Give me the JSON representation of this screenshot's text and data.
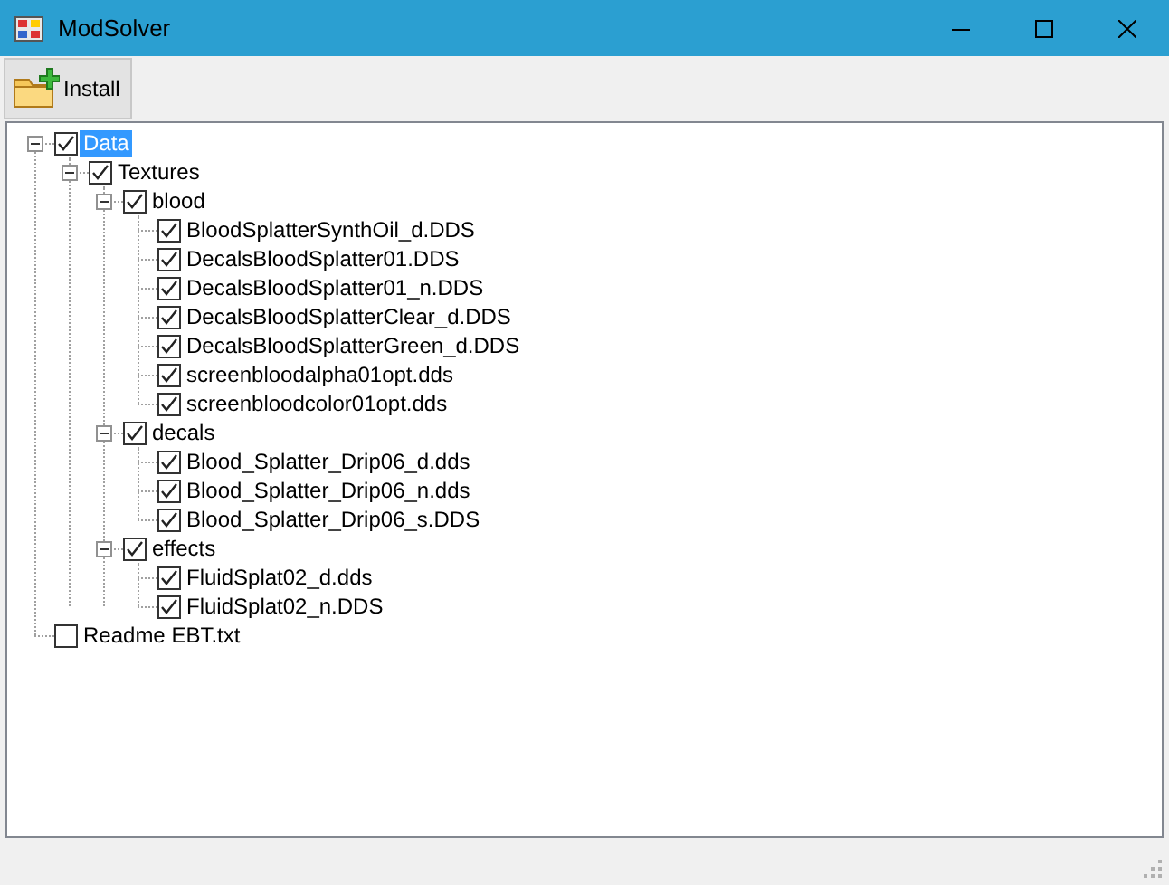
{
  "window": {
    "title": "ModSolver"
  },
  "toolbar": {
    "buttons": [
      {
        "label": "Install"
      }
    ]
  },
  "tree": [
    {
      "label": "Data",
      "checked": true,
      "selected": true,
      "expanded": true,
      "children": [
        {
          "label": "Textures",
          "checked": true,
          "selected": false,
          "expanded": true,
          "children": [
            {
              "label": "blood",
              "checked": true,
              "selected": false,
              "expanded": true,
              "children": [
                {
                  "label": "BloodSplatterSynthOil_d.DDS",
                  "checked": true,
                  "selected": false
                },
                {
                  "label": "DecalsBloodSplatter01.DDS",
                  "checked": true,
                  "selected": false
                },
                {
                  "label": "DecalsBloodSplatter01_n.DDS",
                  "checked": true,
                  "selected": false
                },
                {
                  "label": "DecalsBloodSplatterClear_d.DDS",
                  "checked": true,
                  "selected": false
                },
                {
                  "label": "DecalsBloodSplatterGreen_d.DDS",
                  "checked": true,
                  "selected": false
                },
                {
                  "label": "screenbloodalpha01opt.dds",
                  "checked": true,
                  "selected": false
                },
                {
                  "label": "screenbloodcolor01opt.dds",
                  "checked": true,
                  "selected": false
                }
              ]
            },
            {
              "label": "decals",
              "checked": true,
              "selected": false,
              "expanded": true,
              "children": [
                {
                  "label": "Blood_Splatter_Drip06_d.dds",
                  "checked": true,
                  "selected": false
                },
                {
                  "label": "Blood_Splatter_Drip06_n.dds",
                  "checked": true,
                  "selected": false
                },
                {
                  "label": "Blood_Splatter_Drip06_s.DDS",
                  "checked": true,
                  "selected": false
                }
              ]
            },
            {
              "label": "effects",
              "checked": true,
              "selected": false,
              "expanded": true,
              "children": [
                {
                  "label": "FluidSplat02_d.dds",
                  "checked": true,
                  "selected": false
                },
                {
                  "label": "FluidSplat02_n.DDS",
                  "checked": true,
                  "selected": false
                }
              ]
            }
          ]
        }
      ]
    },
    {
      "label": "Readme EBT.txt",
      "checked": false,
      "selected": false
    }
  ]
}
